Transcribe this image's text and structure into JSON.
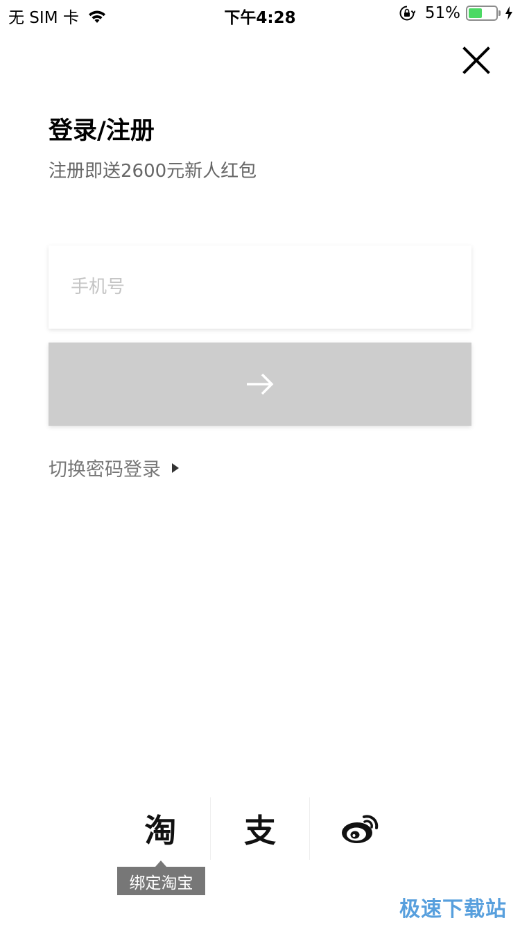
{
  "status_bar": {
    "carrier": "无 SIM 卡",
    "time": "下午4:28",
    "battery_percent": "51%",
    "battery_level": 0.51,
    "battery_color": "#4cd964"
  },
  "header": {
    "title": "登录/注册",
    "subtitle": "注册即送2600元新人红包"
  },
  "form": {
    "phone_placeholder": "手机号",
    "phone_value": "",
    "next_button_icon": "arrow-right-icon",
    "next_button_color": "#cdcdcd"
  },
  "switch_link": {
    "label": "切换密码登录",
    "icon": "triangle-right-icon"
  },
  "social_login": {
    "taobao_glyph": "淘",
    "alipay_glyph": "支",
    "weibo_icon": "weibo-icon",
    "tooltip": "绑定淘宝"
  },
  "watermark": "极速下载站",
  "icons": {
    "close": "close-icon",
    "wifi": "wifi-icon",
    "rotation_lock": "rotation-lock-icon",
    "charging": "bolt-icon"
  }
}
